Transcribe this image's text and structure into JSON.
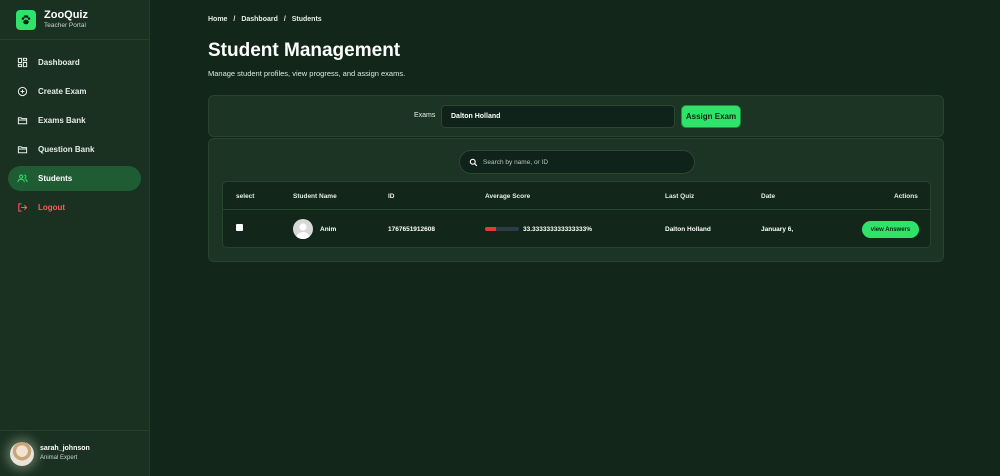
{
  "brand": {
    "name": "ZooQuiz",
    "subtitle": "Teacher Portal"
  },
  "sidebar": {
    "items": [
      {
        "label": "Dashboard",
        "icon": "grid-icon",
        "active": false
      },
      {
        "label": "Create Exam",
        "icon": "plus-circle-icon",
        "active": false
      },
      {
        "label": "Exams Bank",
        "icon": "folder-icon",
        "active": false
      },
      {
        "label": "Question Bank",
        "icon": "folder-icon",
        "active": false
      },
      {
        "label": "Students",
        "icon": "users-icon",
        "active": true
      },
      {
        "label": "Logout",
        "icon": "logout-icon",
        "active": false
      }
    ]
  },
  "user": {
    "name": "sarah_johnson",
    "role": "Animal Expert"
  },
  "breadcrumb": [
    "Home",
    "/",
    "Dashboard",
    "/",
    "Students"
  ],
  "page": {
    "title": "Student Management",
    "subtitle": "Manage student profiles, view progress, and assign exams."
  },
  "assign": {
    "exam_label": "Exams",
    "exam_value": "Dalton Holland",
    "button_label": "Assign Exam"
  },
  "search": {
    "placeholder": "Search by name, or ID"
  },
  "table": {
    "headers": [
      "select",
      "Student Name",
      "ID",
      "Average Score",
      "Last Quiz",
      "Date",
      "Actions"
    ],
    "rows": [
      {
        "name": "Anim",
        "id": "1767651912608",
        "average_score": "33.333333333333333%",
        "score_fraction": 0.333,
        "last_quiz": "Dalton Holland",
        "date": "January 6,",
        "action_label": "view Answers"
      }
    ]
  },
  "colors": {
    "accent": "#2ee26a",
    "background": "#13261a",
    "sidebar": "#1a3021",
    "logout": "#ff5a5a",
    "progress_fill": "#e53935"
  }
}
